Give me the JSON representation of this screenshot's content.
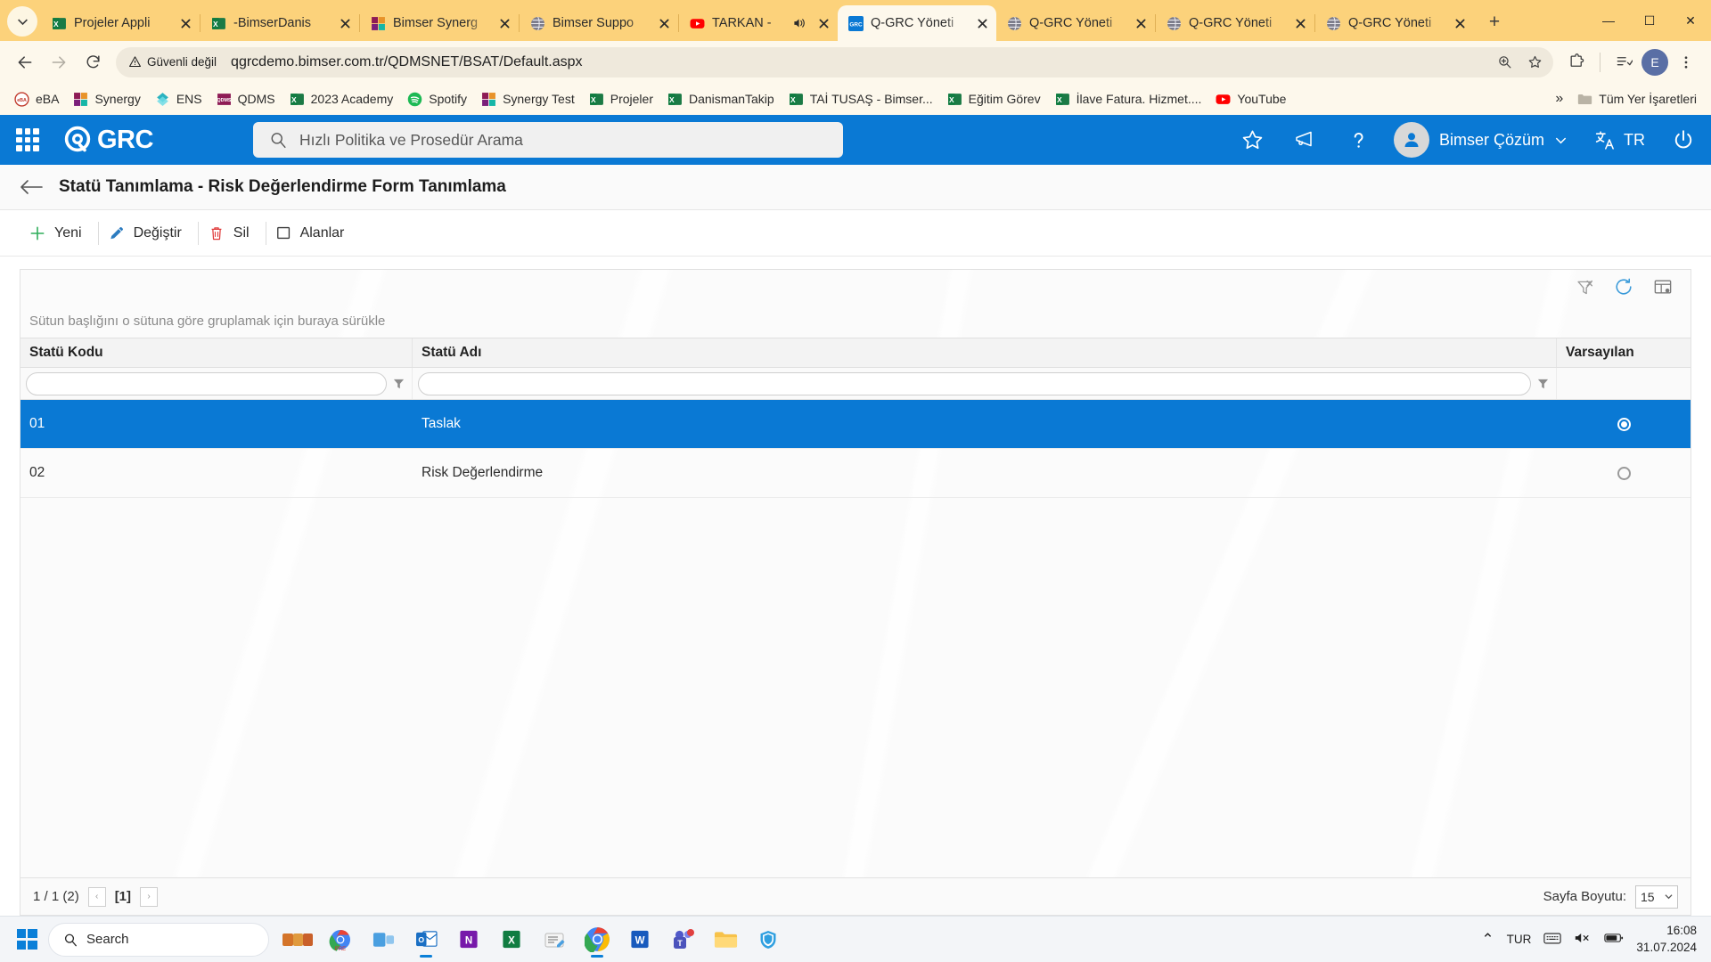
{
  "browser": {
    "tabs": [
      {
        "label": "Projeler Appli",
        "icon": "excel-icon",
        "active": false,
        "audio": false
      },
      {
        "label": "-BimserDanis",
        "icon": "excel-icon",
        "active": false,
        "audio": false
      },
      {
        "label": "Bimser Synerg",
        "icon": "synergy-icon",
        "active": false,
        "audio": false
      },
      {
        "label": "Bimser Suppo",
        "icon": "globe-icon",
        "active": false,
        "audio": false
      },
      {
        "label": "TARKAN -",
        "icon": "youtube-icon",
        "active": false,
        "audio": true
      },
      {
        "label": "Q-GRC Yöneti",
        "icon": "qgrc-icon",
        "active": true,
        "audio": false
      },
      {
        "label": "Q-GRC Yöneti",
        "icon": "globe-icon",
        "active": false,
        "audio": false
      },
      {
        "label": "Q-GRC Yöneti",
        "icon": "globe-icon",
        "active": false,
        "audio": false
      },
      {
        "label": "Q-GRC Yöneti",
        "icon": "globe-icon",
        "active": false,
        "audio": false
      }
    ],
    "new_tab_label": "+",
    "window_controls": {
      "minimize": "—",
      "maximize": "☐",
      "close": "✕"
    },
    "security_label": "Güvenli değil",
    "url": "qgrcdemo.bimser.com.tr/QDMSNET/BSAT/Default.aspx",
    "profile_initial": "E",
    "bookmarks": [
      {
        "label": "eBA",
        "icon": "eba-icon"
      },
      {
        "label": "Synergy",
        "icon": "synergy-icon"
      },
      {
        "label": "ENS",
        "icon": "ens-icon"
      },
      {
        "label": "QDMS",
        "icon": "qdms-icon"
      },
      {
        "label": "2023 Academy",
        "icon": "excel-icon"
      },
      {
        "label": "Spotify",
        "icon": "spotify-icon"
      },
      {
        "label": "Synergy Test",
        "icon": "synergy-icon"
      },
      {
        "label": "Projeler",
        "icon": "excel-icon"
      },
      {
        "label": "DanismanTakip",
        "icon": "excel-icon"
      },
      {
        "label": "TAİ TUSAŞ - Bimser...",
        "icon": "excel-icon"
      },
      {
        "label": "Eğitim Görev",
        "icon": "excel-icon"
      },
      {
        "label": "İlave Fatura. Hizmet....",
        "icon": "excel-icon"
      },
      {
        "label": "YouTube",
        "icon": "youtube-icon"
      }
    ],
    "bookmarks_overflow": "»",
    "all_bookmarks_label": "Tüm Yer İşaretleri"
  },
  "app": {
    "brand": "GRC",
    "search_placeholder": "Hızlı Politika ve Prosedür Arama",
    "user_name": "Bimser Çözüm",
    "language": "TR",
    "accent_color": "#0a79d4",
    "page_title": "Statü Tanımlama - Risk Değerlendirme Form Tanımlama",
    "toolbar": [
      {
        "label": "Yeni",
        "icon": "plus-icon",
        "color": "#2eae5a"
      },
      {
        "label": "Değiştir",
        "icon": "pencil-icon",
        "color": "#2c7cc0"
      },
      {
        "label": "Sil",
        "icon": "trash-icon",
        "color": "#e03b3b"
      },
      {
        "label": "Alanlar",
        "icon": "square-icon",
        "color": "#3a3a3a"
      }
    ]
  },
  "grid": {
    "group_hint": "Sütun başlığını o sütuna göre gruplamak için buraya sürükle",
    "columns": [
      "Statü Kodu",
      "Statü Adı",
      "Varsayılan"
    ],
    "filters": [
      "",
      ""
    ],
    "rows": [
      {
        "code": "01",
        "name": "Taslak",
        "default": true,
        "selected": true
      },
      {
        "code": "02",
        "name": "Risk Değerlendirme",
        "default": false,
        "selected": false
      }
    ],
    "tools": [
      "clear-filter-icon",
      "refresh-icon",
      "column-chooser-icon"
    ],
    "pager": {
      "summary": "1 / 1 (2)",
      "prev": "‹",
      "current_page": "[1]",
      "next": "›",
      "page_size_label": "Sayfa Boyutu:",
      "page_size_value": "15"
    }
  },
  "taskbar": {
    "search_placeholder": "Search",
    "apps": [
      {
        "name": "start-button",
        "icon": "windows-logo"
      },
      {
        "name": "widgets",
        "icon": "weather-icon"
      },
      {
        "name": "chrome-pre",
        "icon": "chrome-pre-icon"
      },
      {
        "name": "task-view",
        "icon": "taskview-icon"
      },
      {
        "name": "outlook",
        "icon": "outlook-icon"
      },
      {
        "name": "onenote",
        "icon": "onenote-icon"
      },
      {
        "name": "excel",
        "icon": "excel-icon"
      },
      {
        "name": "notepad",
        "icon": "notepad-icon"
      },
      {
        "name": "chrome",
        "icon": "chrome-icon"
      },
      {
        "name": "word",
        "icon": "word-icon"
      },
      {
        "name": "teams",
        "icon": "teams-icon"
      },
      {
        "name": "file-explorer",
        "icon": "folder-icon"
      },
      {
        "name": "security",
        "icon": "shield-icon"
      }
    ],
    "tray_chevron": "⌃",
    "language": "TUR",
    "time": "16:08",
    "date": "31.07.2024"
  }
}
